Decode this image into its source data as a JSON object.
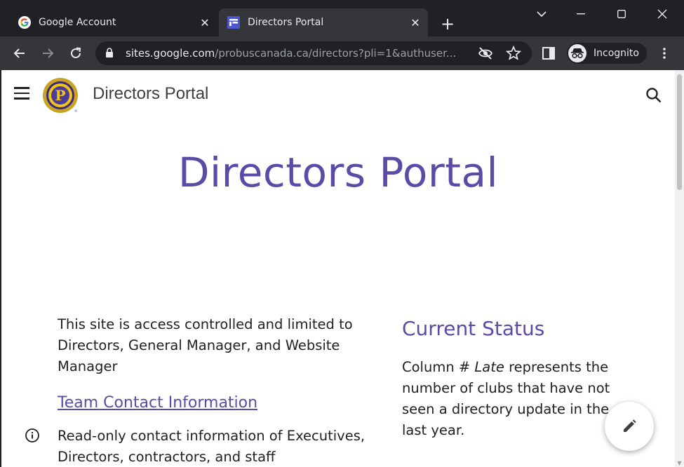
{
  "tabs": [
    {
      "title": "Google Account",
      "favicon": "google-icon",
      "active": false
    },
    {
      "title": "Directors Portal",
      "favicon": "google-sites-icon",
      "active": true
    }
  ],
  "address_bar": {
    "host": "sites.google.com",
    "path": "/probuscanada.ca/directors?pli=1&authuser..."
  },
  "profile": {
    "label": "Incognito"
  },
  "site": {
    "header_title": "Directors Portal",
    "hero_title": "Directors Portal"
  },
  "left_column": {
    "intro": "This site is access controlled and limited to Directors, General Manager, and Website Manager",
    "link_text": "Team Contact Information",
    "link_description": "Read-only contact information of Executives, Directors, contractors, and staff"
  },
  "right_column": {
    "heading": "Current Status",
    "text_before": "Column # ",
    "text_italic": "Late",
    "text_after": " represents the number of clubs that have not seen a directory update in the last year."
  },
  "colors": {
    "accent": "#5b4aa6",
    "chrome_dark": "#202124",
    "chrome_toolbar": "#35363a"
  }
}
